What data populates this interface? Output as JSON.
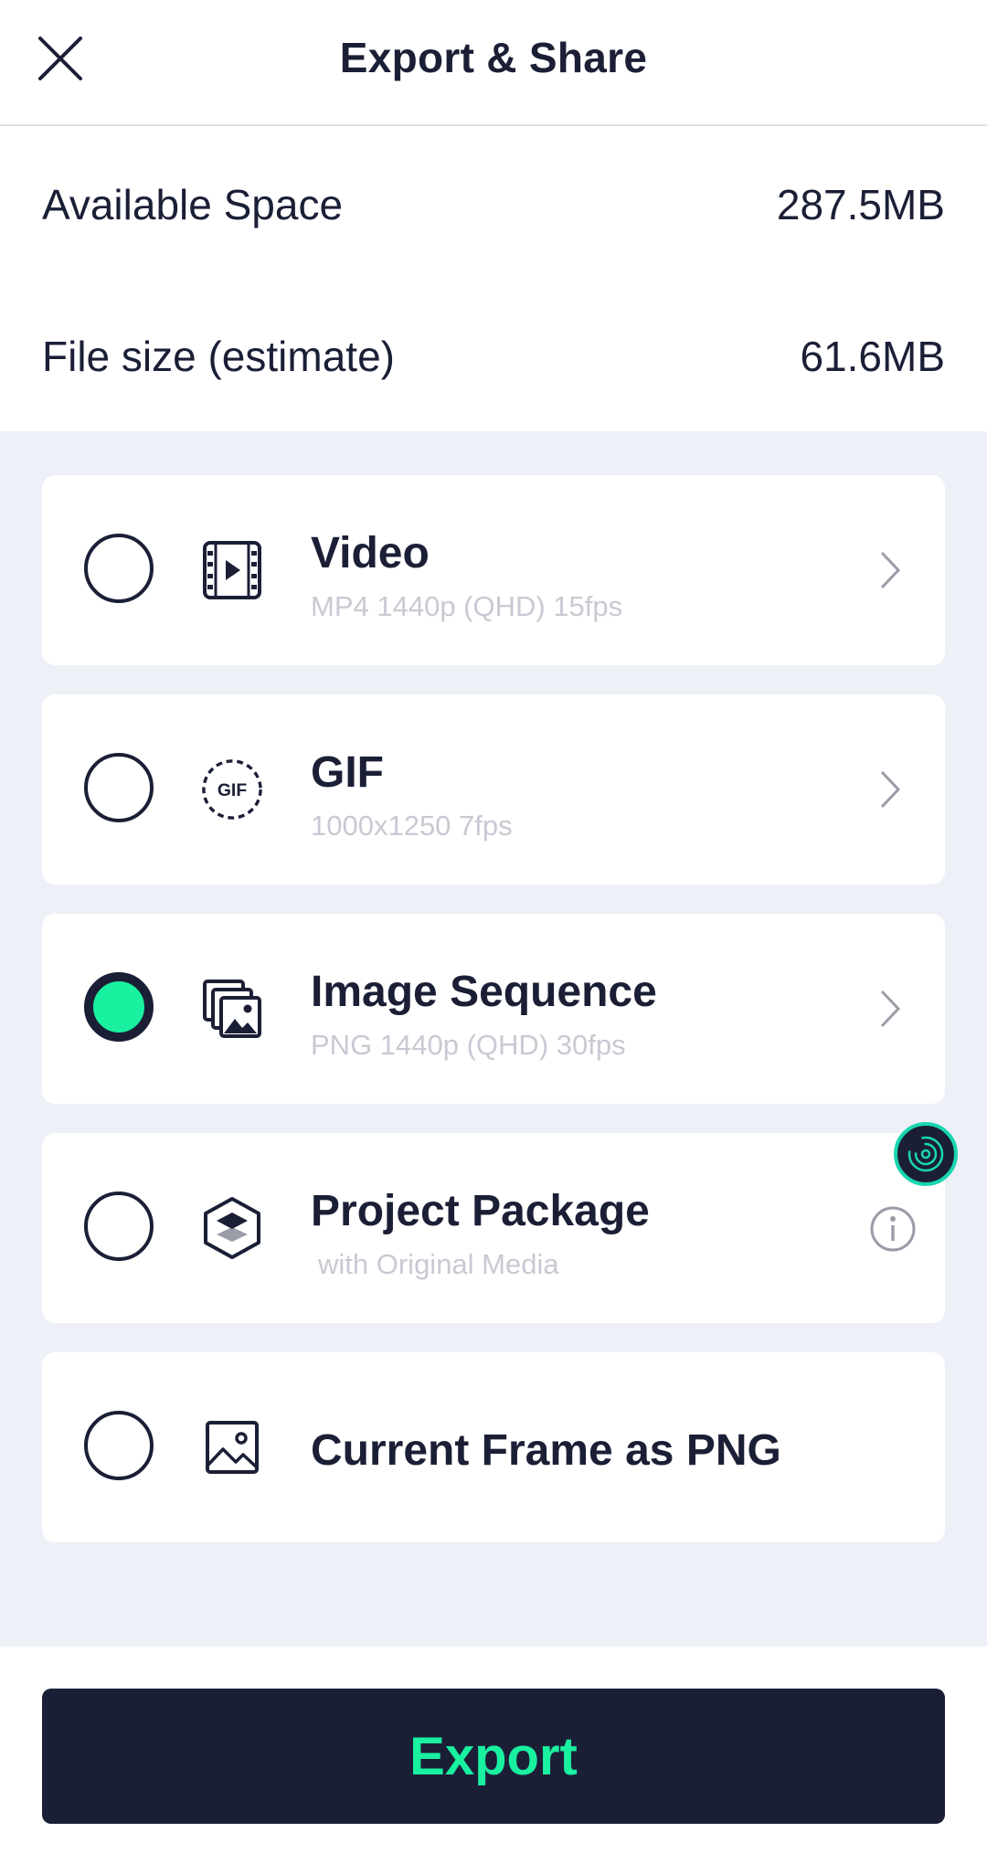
{
  "header": {
    "title": "Export & Share",
    "close_icon": "close-icon"
  },
  "storage": {
    "available_label": "Available Space",
    "available_value": "287.5MB",
    "filesize_label": "File size (estimate)",
    "filesize_value": "61.6MB"
  },
  "options": [
    {
      "title": "Video",
      "subtitle": "MP4 1440p (QHD) 15fps",
      "icon": "video-icon",
      "selected": false,
      "trailing": "chevron-right-icon"
    },
    {
      "title": "GIF",
      "subtitle": "1000x1250 7fps",
      "icon": "gif-icon",
      "icon_text": "GIF",
      "selected": false,
      "trailing": "chevron-right-icon"
    },
    {
      "title": "Image Sequence",
      "subtitle": "PNG 1440p (QHD) 30fps",
      "icon": "image-sequence-icon",
      "selected": true,
      "trailing": "chevron-right-icon"
    },
    {
      "title": "Project Package",
      "subtitle": "with Original Media",
      "icon": "layers-icon",
      "selected": false,
      "trailing": "info-icon"
    },
    {
      "title": "Current Frame as PNG",
      "subtitle": "",
      "icon": "image-icon",
      "selected": false,
      "trailing": ""
    }
  ],
  "export_button": {
    "label": "Export"
  },
  "colors": {
    "primary": "#1b1f36",
    "accent": "#19f0a0",
    "background": "#eef0f7",
    "subtitle": "#c8cad3"
  }
}
